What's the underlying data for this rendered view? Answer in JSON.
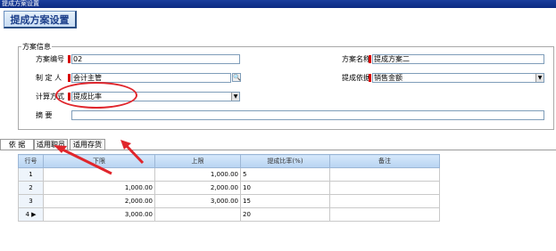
{
  "window": {
    "title": "提成方案设置"
  },
  "header": {
    "button_label": "提成方案设置"
  },
  "group": {
    "title": "方案信息"
  },
  "form": {
    "code_label": "方案编号",
    "code_value": "02",
    "name_label": "方案名称",
    "name_value": "提成方案二",
    "creator_label": "制 定 人",
    "creator_value": "会计主管",
    "basis_label": "提成依据",
    "basis_value": "销售金额",
    "method_label": "计算方式",
    "method_value": "提成比率",
    "summary_label": "摘      要",
    "summary_value": ""
  },
  "tabs": [
    "依  据",
    "适用职员",
    "适用存货"
  ],
  "grid": {
    "columns": [
      "行号",
      "下限",
      "上限",
      "提成比率(%)",
      "备注"
    ],
    "rows": [
      {
        "no": "1",
        "lower": "",
        "upper": "1,000.00",
        "rate": "5",
        "note": ""
      },
      {
        "no": "2",
        "lower": "1,000.00",
        "upper": "2,000.00",
        "rate": "10",
        "note": ""
      },
      {
        "no": "3",
        "lower": "2,000.00",
        "upper": "3,000.00",
        "rate": "15",
        "note": ""
      },
      {
        "no": "4",
        "lower": "3,000.00",
        "upper": "",
        "rate": "20",
        "note": ""
      }
    ]
  },
  "colors": {
    "annotation": "#e0262c",
    "title_bar": "#0b2a82",
    "grid_header": "#b7d3f1"
  }
}
